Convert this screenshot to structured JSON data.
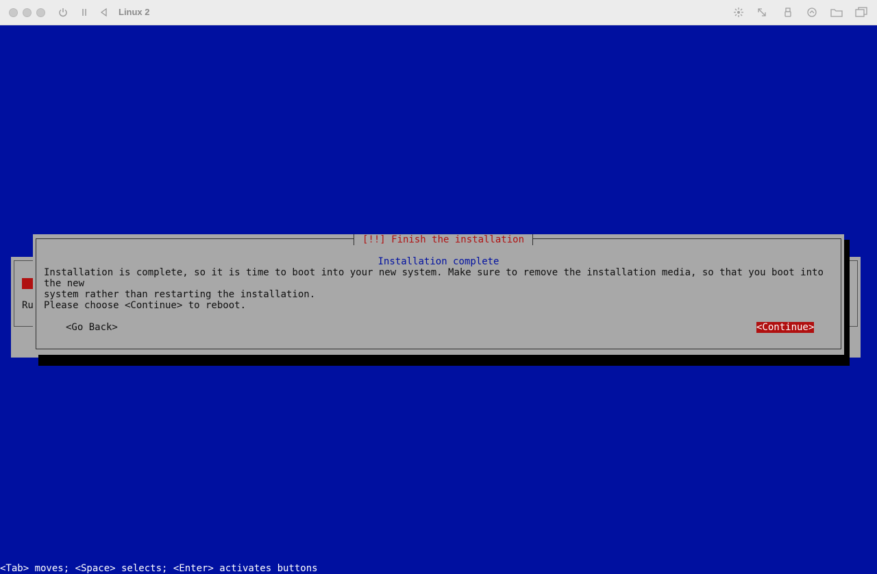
{
  "window": {
    "title": "Linux 2",
    "toolbar_icons": [
      "power-icon",
      "pause-icon",
      "back-icon",
      "brightness-icon",
      "resize-icon",
      "usb-icon",
      "network-icon",
      "shared-folder-icon",
      "window-icon"
    ]
  },
  "background_dialog": {
    "partial_text": "Ru"
  },
  "dialog": {
    "title": "[!!] Finish the installation",
    "subtitle": "Installation complete",
    "message": "Installation is complete, so it is time to boot into your new system. Make sure to remove the installation media, so that you boot into the new\nsystem rather than restarting the installation.",
    "prompt": "Please choose <Continue> to reboot.",
    "go_back_label": "<Go Back>",
    "continue_label": "<Continue>"
  },
  "helpline": "<Tab> moves; <Space> selects; <Enter> activates buttons",
  "colors": {
    "screen_background": "#0010a0",
    "dialog_background": "#a8a8a8",
    "accent_red": "#b01010",
    "subtitle_blue": "#0010a0"
  }
}
